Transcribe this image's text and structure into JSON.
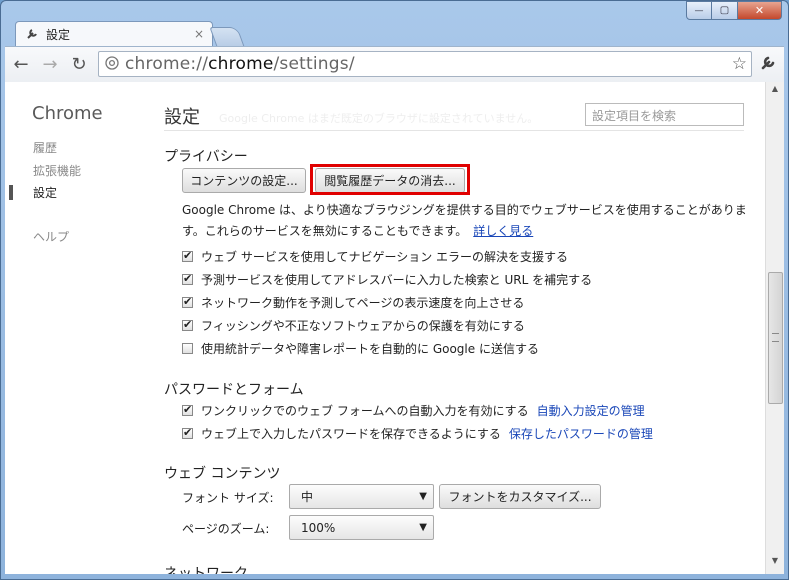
{
  "window": {
    "tab_title": "設定",
    "tab_close": "×",
    "min": "—",
    "max": "▢",
    "close": "✕"
  },
  "toolbar": {
    "back": "←",
    "forward": "→",
    "reload": "↻",
    "url_prefix": "chrome://",
    "url_host": "chrome",
    "url_path": "/settings/",
    "star": "☆"
  },
  "sidebar": {
    "brand": "Chrome",
    "items": [
      {
        "label": "履歴"
      },
      {
        "label": "拡張機能"
      },
      {
        "label": "設定"
      },
      {
        "label": "ヘルプ"
      }
    ]
  },
  "header": {
    "title": "設定",
    "ghost_text": "Google Chrome はまだ既定のブラウザに設定されていません。",
    "search_placeholder": "設定項目を検索"
  },
  "privacy": {
    "heading": "プライバシー",
    "content_settings_button": "コンテンツの設定...",
    "clear_data_button": "閲覧履歴データの消去...",
    "description": "Google Chrome は、より快適なブラウジングを提供する目的でウェブサービスを使用することがあります。これらのサービスを無効にすることもできます。",
    "learn_more": "詳しく見る",
    "options": [
      {
        "label": "ウェブ サービスを使用してナビゲーション エラーの解決を支援する",
        "checked": true
      },
      {
        "label": "予測サービスを使用してアドレスバーに入力した検索と URL を補完する",
        "checked": true
      },
      {
        "label": "ネットワーク動作を予測してページの表示速度を向上させる",
        "checked": true
      },
      {
        "label": "フィッシングや不正なソフトウェアからの保護を有効にする",
        "checked": true
      },
      {
        "label": "使用統計データや障害レポートを自動的に Google に送信する",
        "checked": false
      }
    ]
  },
  "passwords": {
    "heading": "パスワードとフォーム",
    "autofill_label": "ワンクリックでのウェブ フォームへの自動入力を有効にする",
    "autofill_link": "自動入力設定の管理",
    "save_pw_label": "ウェブ上で入力したパスワードを保存できるようにする",
    "save_pw_link": "保存したパスワードの管理"
  },
  "web_content": {
    "heading": "ウェブ コンテンツ",
    "font_size_label": "フォント サイズ:",
    "font_size_value": "中",
    "customize_fonts_button": "フォントをカスタマイズ...",
    "zoom_label": "ページのズーム:",
    "zoom_value": "100%"
  },
  "network": {
    "heading": "ネットワーク"
  },
  "colors": {
    "highlight": "#e00000",
    "link": "#1a47b8"
  }
}
